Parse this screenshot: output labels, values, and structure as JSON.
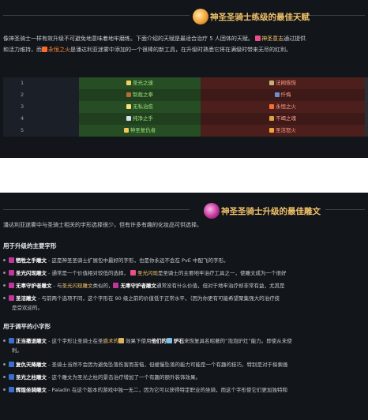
{
  "colors": {
    "panel_bg": "#121519",
    "title_gold": "#f3c36b",
    "row_green": "#264d24",
    "row_green_alt": "#1f3f1e",
    "row_red": "#4d1f1c",
    "row_red_alt": "#3d1917",
    "link_orange": "#ff8a3d"
  },
  "talents": {
    "title": "神圣圣骑士练级的最佳天赋",
    "intro_line1_a": "像神圣骑士一样有效升级不可避免地意味着地牢磨练。下面介绍的天赋是最适合治疗 5 人团体的天赋。",
    "intro_line1_b": "神圣意志",
    "intro_line1_c": "通过提供",
    "intro_line2_a": "和活力维持，而",
    "intro_line2_b": "永恒之火",
    "intro_line2_c": "是潘达利亚迷雾中添加的一个很棒的新工具，在升级时熟悉它将在满级时带来无尽的红利。",
    "rows": [
      {
        "tier": "1",
        "left": "圣光之速",
        "right": "法网恢恢"
      },
      {
        "tier": "2",
        "left": "制裁之拳",
        "right": "忏悔"
      },
      {
        "tier": "3",
        "left": "无私治愈",
        "right": "永恒之火"
      },
      {
        "tier": "4",
        "left": "纯净之手",
        "right": "不竭之魂"
      },
      {
        "tier": "5",
        "left": "神圣复仇者",
        "right": "圣洁怒火"
      }
    ]
  },
  "glyphs": {
    "title": "神圣圣骑士升级的最佳雕文",
    "intro": "潘达利亚迷雾中与圣骑士相关的字形选择很少，但有许多有趣的化妆品可供选择。",
    "major_heading": "用于升级的主要字形",
    "major": [
      {
        "name": "牺牲之手雕文",
        "text": " - 这是神圣圣骑士扩展包中最好的字形，也是你永远不会在 PvE 中配飞的字形。"
      },
      {
        "name": "圣光闪现雕文",
        "text": " - 通常是一个价值相对较低的选择，",
        "link": "圣光闪现",
        "text2": "是圣骑士的主要地牢治疗工具之一，使雕文成为一个很好"
      },
      {
        "name": "无辜守护者雕文",
        "text": " - 与",
        "link": "圣光闪现雕文",
        "text2": "类似的，",
        "name2": "无辜守护者雕文",
        "text3": "通常没有什么价值，但对于地牢治疗却非常有益，尤其是"
      },
      {
        "name": "圣洁雕文",
        "text": " - 与前两个选项不同，这个字形在 90 级之前的价值低于正常水平，（因为你更有可能希望聚集强大的治疗技"
      },
      {
        "text": "是受欢迎的。"
      }
    ],
    "minor_heading": "用于调平的小字形",
    "minor": [
      {
        "name": "正当撤退雕文",
        "text": " - 这个字形让圣骑士在圣",
        "link": "盾术的",
        "text2": "效果下使用",
        "name2": "他们的",
        "link2": "炉石",
        "text3": "来恢复具名昭著的“泡泡炉灶”能力。即使从未使"
      },
      {
        "text": "利。"
      },
      {
        "name": "复仇天降雕文",
        "text": " - 圣骑士当然不会因为避免坠落伤害而苦恼，但缓慢坠落的能力可能是一个有趣的技巧，特别是对于探索画"
      },
      {
        "name": "圣光之柱雕文",
        "text": " - 这个雕文为圣光之柱的景击治疗增加了一个有趣的额外装饰效果。"
      },
      {
        "name": "辉煌坐骑雕文",
        "text": " - Paladin 在这个版本的游戏中独一无二，因为它可以获得特定职业的坐骑，而这个字形使它们更加独特和"
      }
    ]
  }
}
